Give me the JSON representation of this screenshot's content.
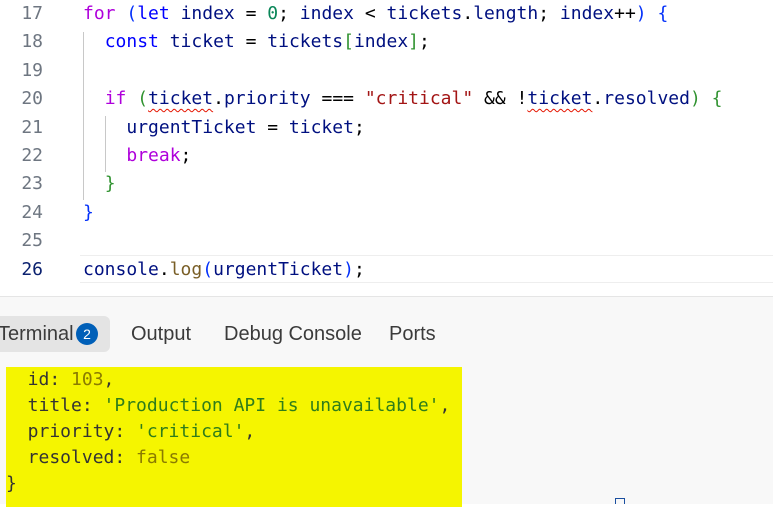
{
  "editor": {
    "lines": [
      {
        "n": "17",
        "parts": [
          {
            "t": "for",
            "c": "kw-ctrl"
          },
          {
            "t": " ",
            "c": ""
          },
          {
            "t": "(",
            "c": "br1"
          },
          {
            "t": "let",
            "c": "kw"
          },
          {
            "t": " ",
            "c": ""
          },
          {
            "t": "index",
            "c": "var"
          },
          {
            "t": " = ",
            "c": ""
          },
          {
            "t": "0",
            "c": "num"
          },
          {
            "t": "; ",
            "c": ""
          },
          {
            "t": "index",
            "c": "var"
          },
          {
            "t": " < ",
            "c": ""
          },
          {
            "t": "tickets",
            "c": "var"
          },
          {
            "t": ".",
            "c": ""
          },
          {
            "t": "length",
            "c": "var"
          },
          {
            "t": "; ",
            "c": ""
          },
          {
            "t": "index",
            "c": "var"
          },
          {
            "t": "++",
            "c": ""
          },
          {
            "t": ")",
            "c": "br1"
          },
          {
            "t": " ",
            "c": ""
          },
          {
            "t": "{",
            "c": "br1"
          }
        ]
      },
      {
        "n": "18",
        "parts": [
          {
            "t": "  ",
            "c": ""
          },
          {
            "t": "const",
            "c": "kw"
          },
          {
            "t": " ",
            "c": ""
          },
          {
            "t": "ticket",
            "c": "var"
          },
          {
            "t": " = ",
            "c": ""
          },
          {
            "t": "tickets",
            "c": "var"
          },
          {
            "t": "[",
            "c": "br2"
          },
          {
            "t": "index",
            "c": "var"
          },
          {
            "t": "]",
            "c": "br2"
          },
          {
            "t": ";",
            "c": ""
          }
        ]
      },
      {
        "n": "19",
        "parts": []
      },
      {
        "n": "20",
        "parts": [
          {
            "t": "  ",
            "c": ""
          },
          {
            "t": "if",
            "c": "kw-ctrl"
          },
          {
            "t": " ",
            "c": ""
          },
          {
            "t": "(",
            "c": "br2"
          },
          {
            "t": "ticket",
            "c": "var squig"
          },
          {
            "t": ".",
            "c": ""
          },
          {
            "t": "priority",
            "c": "var"
          },
          {
            "t": " === ",
            "c": ""
          },
          {
            "t": "\"critical\"",
            "c": "str"
          },
          {
            "t": " && !",
            "c": ""
          },
          {
            "t": "ticket",
            "c": "var squig"
          },
          {
            "t": ".",
            "c": ""
          },
          {
            "t": "resolved",
            "c": "var"
          },
          {
            "t": ")",
            "c": "br2"
          },
          {
            "t": " ",
            "c": ""
          },
          {
            "t": "{",
            "c": "br2"
          }
        ]
      },
      {
        "n": "21",
        "parts": [
          {
            "t": "    ",
            "c": ""
          },
          {
            "t": "urgentTicket",
            "c": "var"
          },
          {
            "t": " = ",
            "c": ""
          },
          {
            "t": "ticket",
            "c": "var"
          },
          {
            "t": ";",
            "c": ""
          }
        ]
      },
      {
        "n": "22",
        "parts": [
          {
            "t": "    ",
            "c": ""
          },
          {
            "t": "break",
            "c": "kw-ctrl"
          },
          {
            "t": ";",
            "c": ""
          }
        ]
      },
      {
        "n": "23",
        "parts": [
          {
            "t": "  ",
            "c": ""
          },
          {
            "t": "}",
            "c": "br2"
          }
        ]
      },
      {
        "n": "24",
        "parts": [
          {
            "t": "}",
            "c": "br1"
          }
        ]
      },
      {
        "n": "25",
        "parts": []
      },
      {
        "n": "26",
        "active": true,
        "parts": [
          {
            "t": "console",
            "c": "var"
          },
          {
            "t": ".",
            "c": ""
          },
          {
            "t": "log",
            "c": "fn"
          },
          {
            "t": "(",
            "c": "br1"
          },
          {
            "t": "urgentTicket",
            "c": "var"
          },
          {
            "t": ")",
            "c": "br1"
          },
          {
            "t": ";",
            "c": ""
          }
        ]
      }
    ]
  },
  "panel": {
    "tabs": {
      "terminal": "Terminal",
      "terminal_badge": "2",
      "output": "Output",
      "debug_console": "Debug Console",
      "ports": "Ports"
    },
    "terminal_output": [
      [
        {
          "t": "  id: ",
          "c": "t-key"
        },
        {
          "t": "103",
          "c": "t-num"
        },
        {
          "t": ",",
          "c": "t-key"
        }
      ],
      [
        {
          "t": "  title: ",
          "c": "t-key"
        },
        {
          "t": "'Production API is unavailable'",
          "c": "t-str"
        },
        {
          "t": ",",
          "c": "t-key"
        }
      ],
      [
        {
          "t": "  priority: ",
          "c": "t-key"
        },
        {
          "t": "'critical'",
          "c": "t-str"
        },
        {
          "t": ",",
          "c": "t-key"
        }
      ],
      [
        {
          "t": "  resolved: ",
          "c": "t-key"
        },
        {
          "t": "false",
          "c": "t-bool"
        }
      ],
      [
        {
          "t": "}",
          "c": "t-key"
        }
      ]
    ]
  }
}
